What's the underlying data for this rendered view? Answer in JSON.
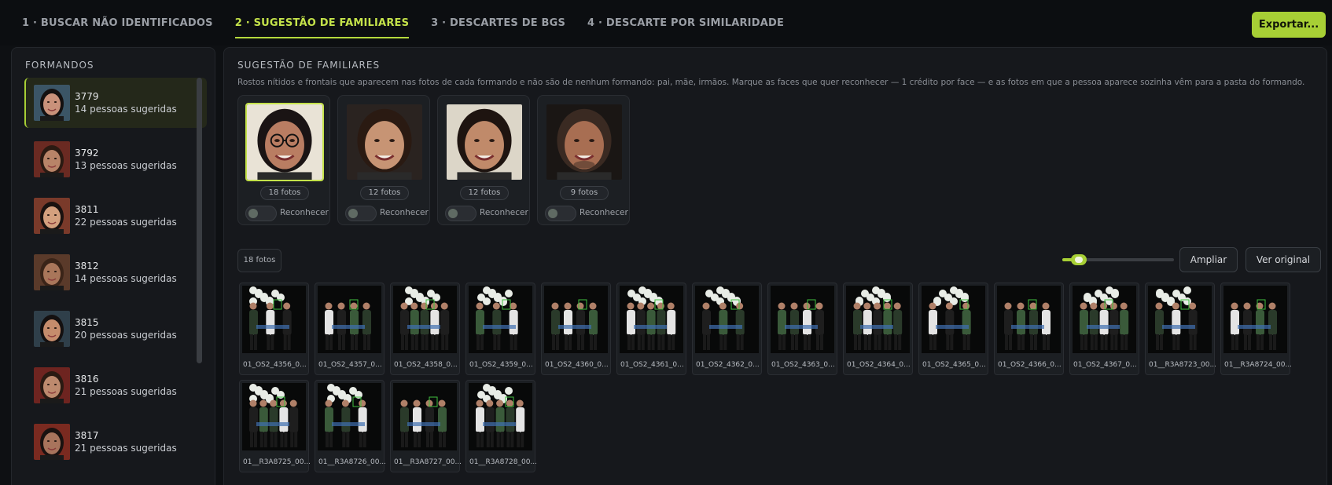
{
  "tabs": [
    {
      "label": "1 · BUSCAR NÃO IDENTIFICADOS",
      "active": false
    },
    {
      "label": "2 · SUGESTÃO DE FAMILIARES",
      "active": true
    },
    {
      "label": "3 · DESCARTES DE BGS",
      "active": false
    },
    {
      "label": "4 · DESCARTE POR SIMILARIDADE",
      "active": false
    }
  ],
  "export_label": "Exportar...",
  "sidebar": {
    "title": "FORMANDOS",
    "items": [
      {
        "id": "3779",
        "sub": "14 pessoas sugeridas",
        "active": true
      },
      {
        "id": "3792",
        "sub": "13 pessoas sugeridas",
        "active": false
      },
      {
        "id": "3811",
        "sub": "22 pessoas sugeridas",
        "active": false
      },
      {
        "id": "3812",
        "sub": "14 pessoas sugeridas",
        "active": false
      },
      {
        "id": "3815",
        "sub": "20 pessoas sugeridas",
        "active": false
      },
      {
        "id": "3816",
        "sub": "21 pessoas sugeridas",
        "active": false
      },
      {
        "id": "3817",
        "sub": "21 pessoas sugeridas",
        "active": false
      }
    ]
  },
  "main": {
    "title": "SUGESTÃO DE FAMILIARES",
    "description": "Rostos nítidos e frontais que aparecem nas fotos de cada formando e não são de nenhum formando: pai, mãe, irmãos. Marque as faces que quer reconhecer — 1 crédito por face — e as fotos em que a pessoa aparece sozinha vêm para a pasta do formando.",
    "faces": [
      {
        "count": "18 fotos",
        "toggle_label": "Reconhecer",
        "selected": true
      },
      {
        "count": "12 fotos",
        "toggle_label": "Reconhecer",
        "selected": false
      },
      {
        "count": "12 fotos",
        "toggle_label": "Reconhecer",
        "selected": false
      },
      {
        "count": "9 fotos",
        "toggle_label": "Reconhecer",
        "selected": false
      }
    ],
    "photos_count": "18 fotos",
    "zoom_level": 0.15,
    "ampliar_label": "Ampliar",
    "ver_original_label": "Ver original",
    "photos": [
      "01_OS2_4356_0...",
      "01_OS2_4357_0...",
      "01_OS2_4358_0...",
      "01_OS2_4359_0...",
      "01_OS2_4360_0...",
      "01_OS2_4361_0...",
      "01_OS2_4362_0...",
      "01_OS2_4363_0...",
      "01_OS2_4364_0...",
      "01_OS2_4365_0...",
      "01_OS2_4366_0...",
      "01_OS2_4367_0...",
      "01__R3A8723_00...",
      "01__R3A8724_00...",
      "01__R3A8725_00...",
      "01__R3A8726_00...",
      "01__R3A8727_00...",
      "01__R3A8728_00..."
    ]
  },
  "colors": {
    "accent": "#a7cf35",
    "tab_active": "#c4e24a",
    "background": "#0e1013",
    "panel": "#16181c"
  }
}
